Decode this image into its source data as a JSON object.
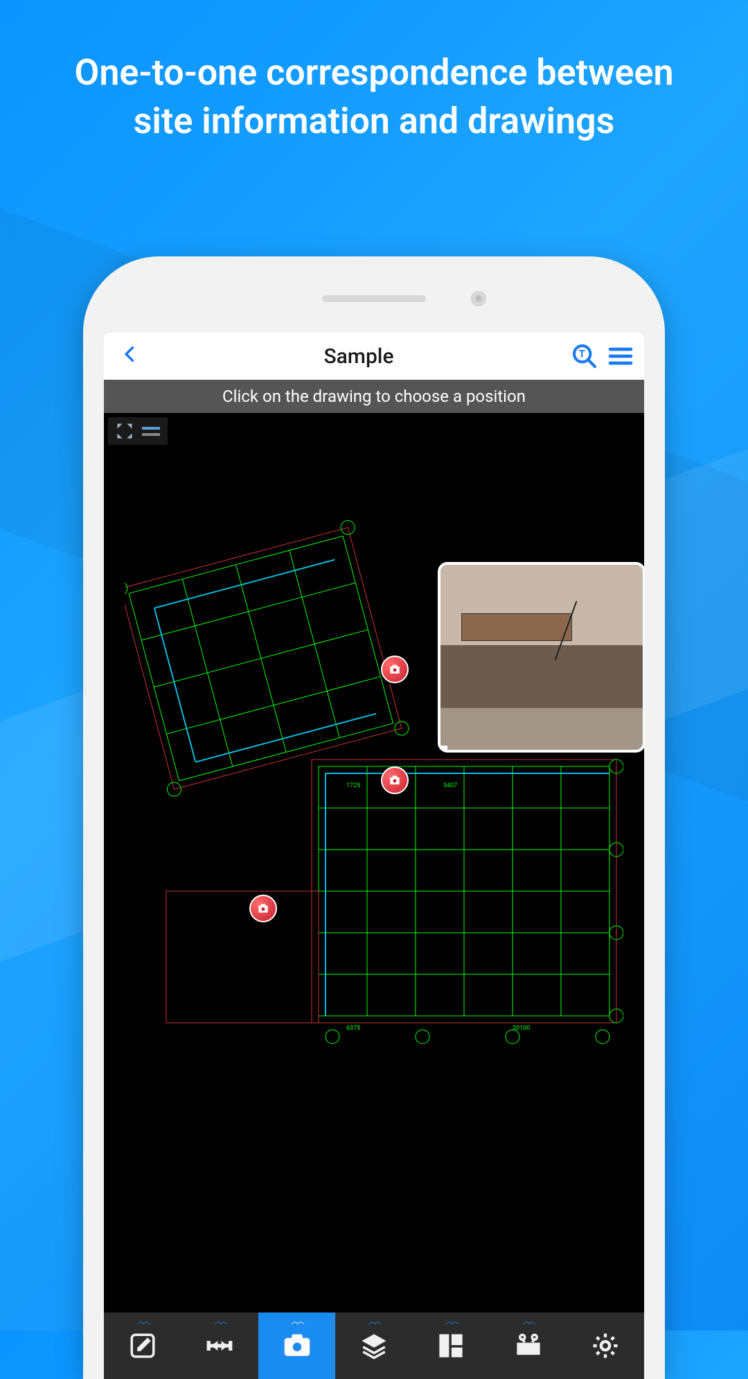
{
  "promo": {
    "headline": "One-to-one correspondence be­tween site information and drawings"
  },
  "appbar": {
    "title": "Sample",
    "back_icon": "chevron-left",
    "search_icon": "search",
    "menu_icon": "hamburger"
  },
  "infobar": {
    "message": "Click on the drawing to choose a position"
  },
  "canvas": {
    "corner_tools": [
      {
        "name": "fullscreen"
      },
      {
        "name": "line-style"
      }
    ],
    "pins": [
      {
        "id": "pin-1",
        "icon": "camera"
      },
      {
        "id": "pin-2",
        "icon": "camera"
      },
      {
        "id": "pin-3",
        "icon": "camera"
      }
    ],
    "photo_callout": {
      "description": "site-photo"
    }
  },
  "toolbar": {
    "items": [
      {
        "name": "edit",
        "icon": "pencil-square",
        "expandable": true,
        "active": false
      },
      {
        "name": "measure",
        "icon": "ruler",
        "expandable": true,
        "active": false
      },
      {
        "name": "camera",
        "icon": "camera",
        "expandable": true,
        "active": true
      },
      {
        "name": "layers",
        "icon": "layers",
        "expandable": true,
        "active": false
      },
      {
        "name": "layout",
        "icon": "layout",
        "expandable": true,
        "active": false
      },
      {
        "name": "toolbox",
        "icon": "toolbox",
        "expandable": true,
        "active": false
      },
      {
        "name": "settings",
        "icon": "gear",
        "expandable": false,
        "active": false
      }
    ]
  }
}
